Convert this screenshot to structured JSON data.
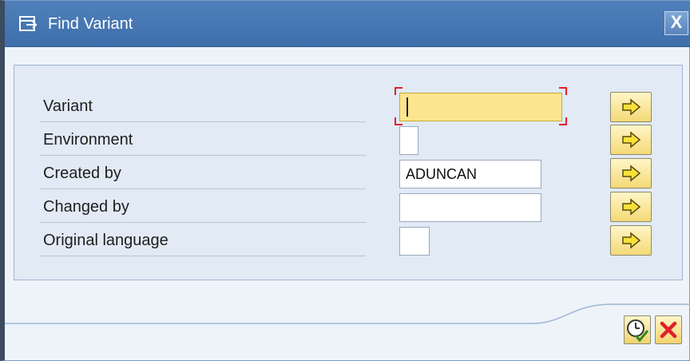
{
  "dialog": {
    "title": "Find Variant",
    "close_label": "X"
  },
  "fields": [
    {
      "label": "Variant",
      "value": "",
      "focused": true
    },
    {
      "label": "Environment",
      "value": ""
    },
    {
      "label": "Created by",
      "value": "ADUNCAN"
    },
    {
      "label": "Changed by",
      "value": ""
    },
    {
      "label": "Original language",
      "value": ""
    }
  ],
  "icons": {
    "title": "dialog-window-icon",
    "select": "yellow-arrow-icon",
    "ok": "clock-checkmark-icon",
    "cancel": "red-x-icon"
  },
  "colors": {
    "titlebar": "#4373b0",
    "focused_field": "#fbe58f",
    "cancel_x": "#e0202a",
    "ok_check": "#2f8a2c"
  }
}
